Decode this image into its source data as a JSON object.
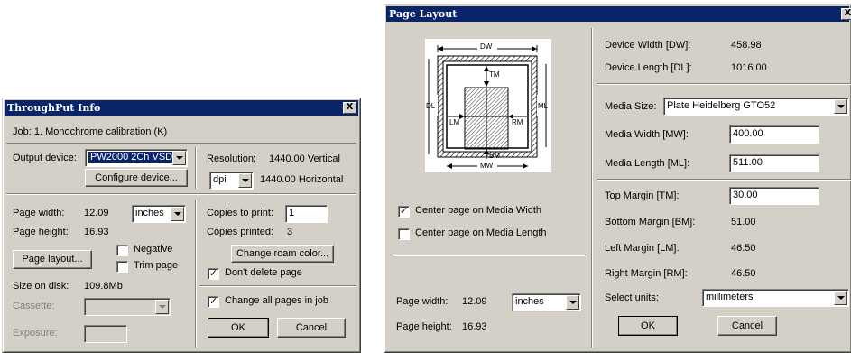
{
  "throughput": {
    "title": "ThroughPut Info",
    "close_glyph": "X",
    "job": "Job:   1. Monochrome calibration (K)",
    "output_device_label": "Output device:",
    "output_device_value": "PW2000 2Ch VSD",
    "configure_button": "Configure device...",
    "resolution_label": "Resolution:",
    "resolution_vertical": "1440.00 Vertical",
    "resolution_unit": "dpi",
    "resolution_horizontal": "1440.00 Horizontal",
    "page_width_label": "Page width:",
    "page_width_value": "12.09",
    "units_value": "inches",
    "page_height_label": "Page height:",
    "page_height_value": "16.93",
    "negative_label": "Negative",
    "trim_page_label": "Trim page",
    "page_layout_button": "Page layout...",
    "size_on_disk_label": "Size on disk:",
    "size_on_disk_value": "109.8Mb",
    "cassette_label": "Cassette:",
    "exposure_label": "Exposure:",
    "copies_to_print_label": "Copies to print:",
    "copies_to_print_value": "1",
    "copies_printed_label": "Copies printed:",
    "copies_printed_value": "3",
    "change_roam_color_button": "Change roam color...",
    "dont_delete_label": "Don't delete page",
    "dont_delete_checked": true,
    "change_all_label": "Change all pages in job",
    "change_all_checked": true,
    "ok_button": "OK",
    "cancel_button": "Cancel"
  },
  "page_layout": {
    "title": "Page Layout",
    "close_glyph": "X",
    "diagram": {
      "dw": "DW",
      "dl": "DL",
      "ml": "ML",
      "tm": "TM",
      "lm": "LM",
      "rm": "RM",
      "bm": "BM",
      "mw": "MW"
    },
    "center_width_label": "Center page on Media Width",
    "center_width_checked": true,
    "center_length_label": "Center page on Media Length",
    "center_length_checked": false,
    "page_width_label": "Page width:",
    "page_width_value": "12.09",
    "units_value": "inches",
    "page_height_label": "Page height:",
    "page_height_value": "16.93",
    "device_width_label": "Device Width [DW]:",
    "device_width_value": "458.98",
    "device_length_label": "Device Length [DL]:",
    "device_length_value": "1016.00",
    "media_size_label": "Media Size:",
    "media_size_value": "Plate Heidelberg GTO52",
    "media_width_label": "Media Width [MW]:",
    "media_width_value": "400.00",
    "media_length_label": "Media Length [ML]:",
    "media_length_value": "511.00",
    "top_margin_label": "Top Margin [TM]:",
    "top_margin_value": "30.00",
    "bottom_margin_label": "Bottom Margin [BM]:",
    "bottom_margin_value": "51.00",
    "left_margin_label": "Left Margin [LM]:",
    "left_margin_value": "46.50",
    "right_margin_label": "Right Margin [RM]:",
    "right_margin_value": "46.50",
    "select_units_label": "Select units:",
    "select_units_value": "millimeters",
    "ok_button": "OK",
    "cancel_button": "Cancel"
  }
}
